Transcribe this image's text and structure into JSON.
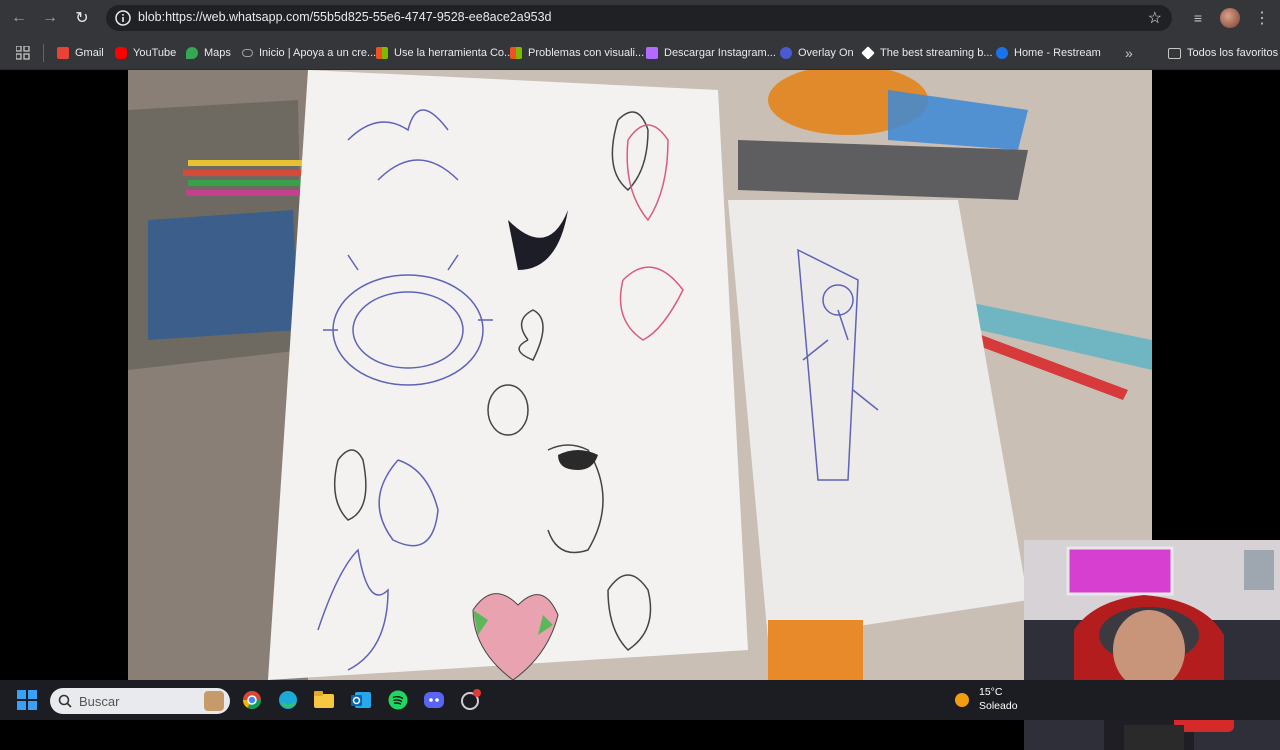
{
  "browser": {
    "url": "blob:https://web.whatsapp.com/55b5d825-55e6-4747-9528-ee8ace2a953d",
    "bookmarks": [
      {
        "label": "Gmail",
        "icon": "gmail-icon",
        "color": "#ea4335"
      },
      {
        "label": "YouTube",
        "icon": "youtube-icon",
        "color": "#ff0000"
      },
      {
        "label": "Maps",
        "icon": "maps-icon",
        "color": "#34a853"
      },
      {
        "label": "Inicio | Apoya a un cre...",
        "icon": "link-icon",
        "color": "#9aa0a6"
      },
      {
        "label": "Use la herramienta Co...",
        "icon": "microsoft-icon",
        "color": "#f25022"
      },
      {
        "label": "Problemas con visuali...",
        "icon": "microsoft-icon",
        "color": "#f25022"
      },
      {
        "label": "Descargar Instagram...",
        "icon": "download-icon",
        "color": "#b36bff"
      },
      {
        "label": "Overlay On",
        "icon": "overlay-icon",
        "color": "#4a5bd1"
      },
      {
        "label": "The best streaming b...",
        "icon": "streaming-icon",
        "color": "#ffffff"
      },
      {
        "label": "Home - Restream",
        "icon": "restream-icon",
        "color": "#1a73e8"
      }
    ],
    "all_bookmarks": "Todos los favoritos"
  },
  "taskbar": {
    "search_label": "Buscar",
    "weather": {
      "temp": "15°C",
      "condition": "Soleado"
    },
    "apps": [
      "chrome-icon",
      "edge-icon",
      "file-explorer-icon",
      "outlook-icon",
      "spotify-icon",
      "discord-icon",
      "app-icon"
    ]
  }
}
